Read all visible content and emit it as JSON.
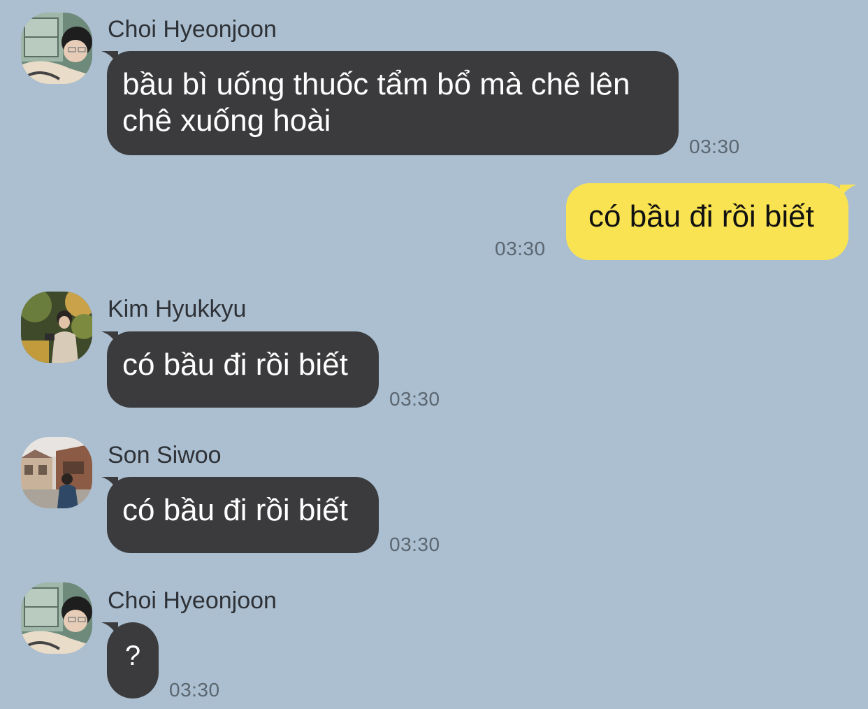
{
  "messages": [
    {
      "sender": "Choi Hyeonjoon",
      "avatar_icon": "avatar-choi-hyeonjoon-icon",
      "text_line1": "bầu bì uống thuốc tẩm bổ mà chê lên",
      "text_line2": "chê xuống hoài",
      "time": "03:30",
      "direction": "incoming"
    },
    {
      "text": "có bầu đi rồi biết",
      "time": "03:30",
      "direction": "outgoing"
    },
    {
      "sender": "Kim Hyukkyu",
      "avatar_icon": "avatar-kim-hyukkyu-icon",
      "text": "có bầu đi rồi biết",
      "time": "03:30",
      "direction": "incoming"
    },
    {
      "sender": "Son Siwoo",
      "avatar_icon": "avatar-son-siwoo-icon",
      "text": "có bầu đi rồi biết",
      "time": "03:30",
      "direction": "incoming"
    },
    {
      "sender": "Choi Hyeonjoon",
      "avatar_icon": "avatar-choi-hyeonjoon-icon",
      "text": "?",
      "time": "03:30",
      "direction": "incoming"
    }
  ],
  "colors": {
    "background": "#abbfd0",
    "incoming_bubble": "#3b3b3d",
    "outgoing_bubble": "#f9e352",
    "timestamp": "#5b6670"
  }
}
